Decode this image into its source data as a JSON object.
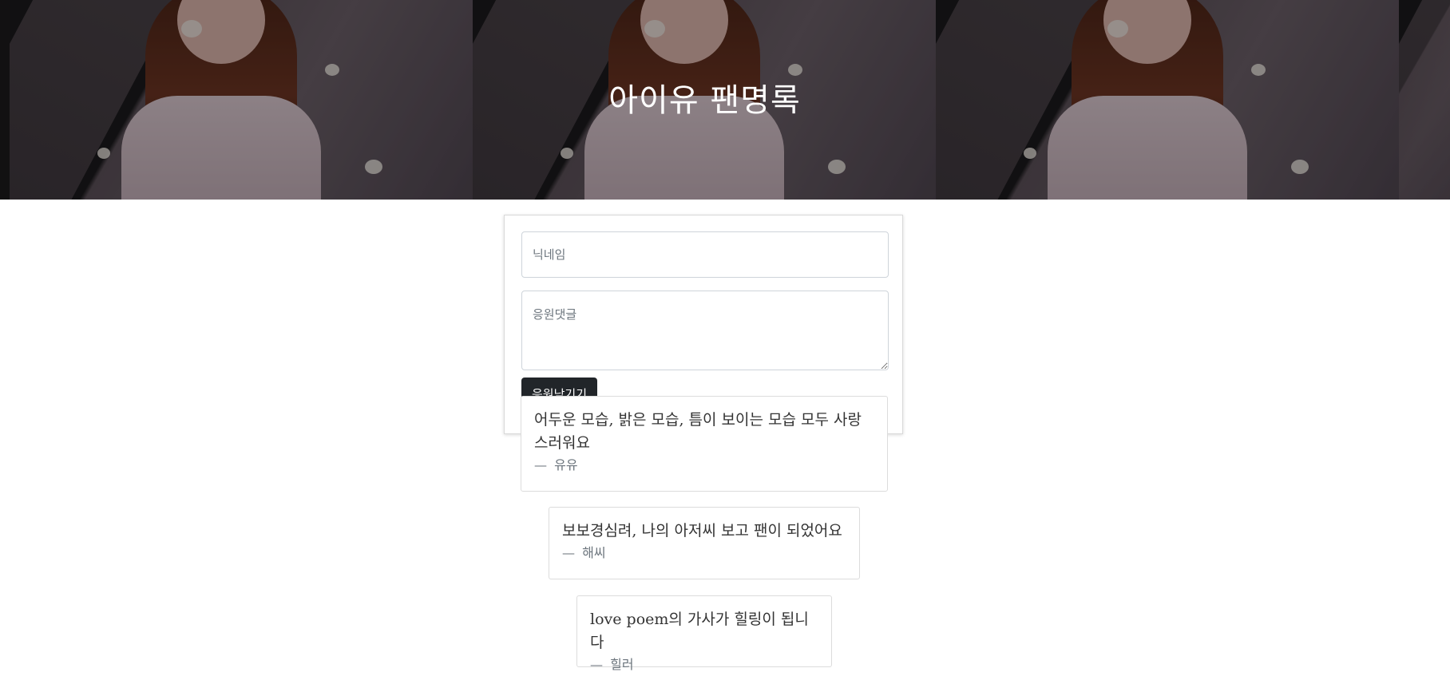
{
  "header": {
    "title": "아이유 팬명록"
  },
  "form": {
    "nickname_placeholder": "닉네임",
    "comment_placeholder": "응원댓글",
    "submit_label": "응원남기기"
  },
  "comments": [
    {
      "text": "어두운 모습, 밝은 모습, 틈이 보이는 모습 모두 사랑스러워요",
      "dash": "—",
      "author": "유유"
    },
    {
      "text": "보보경심려, 나의 아저씨 보고 팬이 되었어요",
      "dash": "—",
      "author": "해씨"
    },
    {
      "text": "love poem의 가사가 힐링이 됩니다",
      "dash": "—",
      "author": "힐러"
    }
  ],
  "colors": {
    "button_bg": "#212529",
    "hero_text": "#ffffff",
    "author_text": "#6c757d"
  }
}
